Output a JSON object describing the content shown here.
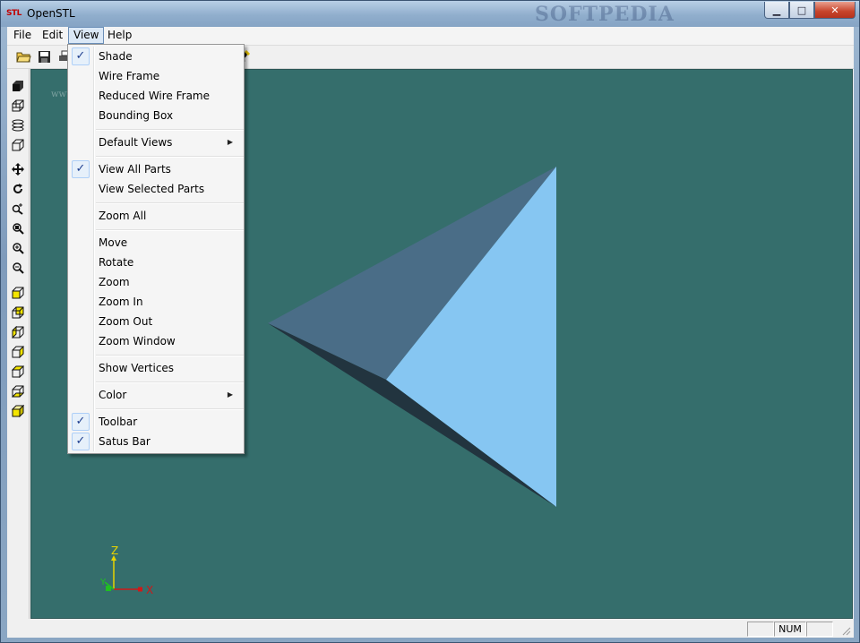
{
  "window": {
    "app_icon_text": "STL",
    "title": "OpenSTL",
    "watermark": "SOFTPEDIA",
    "minimize_glyph": "▁",
    "maximize_glyph": "□",
    "close_glyph": "✕"
  },
  "menubar": {
    "items": [
      {
        "label": "File"
      },
      {
        "label": "Edit"
      },
      {
        "label": "View"
      },
      {
        "label": "Help"
      }
    ],
    "active": "View"
  },
  "toolbar": {
    "buttons": [
      "open-folder-icon",
      "save-icon",
      "print-icon",
      "help-icon"
    ]
  },
  "view_menu": {
    "items": [
      {
        "label": "Shade",
        "checked": true
      },
      {
        "label": "Wire Frame",
        "checked": false
      },
      {
        "label": "Reduced Wire Frame",
        "checked": false
      },
      {
        "label": "Bounding Box",
        "checked": false
      },
      {
        "label": "Default Views",
        "submenu": true
      },
      {
        "label": "View All Parts",
        "checked": true
      },
      {
        "label": "View Selected Parts",
        "checked": false
      },
      {
        "label": "Zoom All",
        "checked": false
      },
      {
        "label": "Move",
        "checked": false
      },
      {
        "label": "Rotate",
        "checked": false
      },
      {
        "label": "Zoom",
        "checked": false
      },
      {
        "label": "Zoom In",
        "checked": false
      },
      {
        "label": "Zoom Out",
        "checked": false
      },
      {
        "label": "Zoom Window",
        "checked": false
      },
      {
        "label": "Show Vertices",
        "checked": false
      },
      {
        "label": "Color",
        "submenu": true
      },
      {
        "label": "Toolbar",
        "checked": true
      },
      {
        "label": "Satus Bar",
        "checked": true
      }
    ],
    "check_glyph": "✓",
    "submenu_glyph": "▶"
  },
  "viewport": {
    "background": "#356e6c",
    "small_watermark": "www.softpedia.com",
    "axes": {
      "z_label": "Z",
      "y_label": "Y",
      "x_label": "X"
    },
    "model_colors": {
      "light_face": "#86c6f2",
      "mid_face": "#4a6d87",
      "dark_face": "#22343f"
    }
  },
  "statusbar": {
    "num_indicator": "NUM"
  }
}
